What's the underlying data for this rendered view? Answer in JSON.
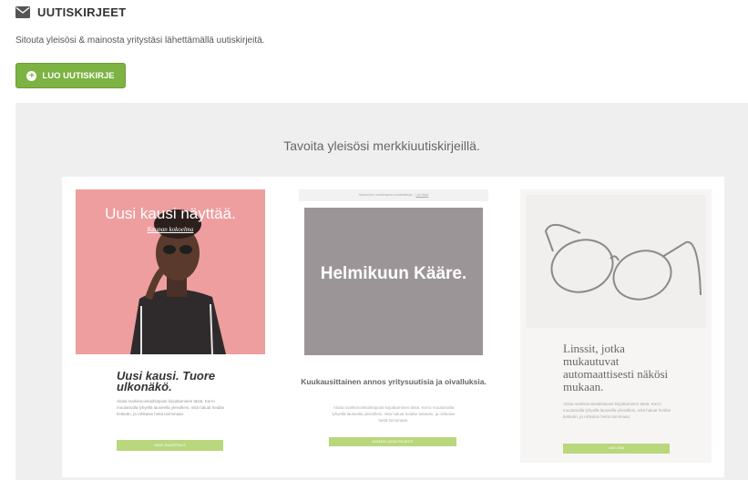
{
  "header": {
    "title": "UUTISKIRJEET",
    "icon": "envelope-icon",
    "subtitle": "Sitouta yleisösi & mainosta yritystäsi lähettämällä uutiskirjeitä."
  },
  "create_button": {
    "label": "LUO UUTISKIRJE",
    "icon": "plus-circle-icon",
    "color": "#7cb342"
  },
  "showcase": {
    "title": "Tavoita yleisösi merkkiuutiskirjeillä.",
    "templates": [
      {
        "hero_title": "Uusi kausi näyttää.",
        "hero_link": "Kaupan kokoelma",
        "body_title": "Uusi kausi. Tuore ulkonäkö.",
        "body_text": "Aloita markkinointiaihiöposti kirjoittaminen tästä. Kerro muutamalla lyhyellä lauseella yleisöllesi, mitä haluat heidän tietävän, ja rohkaise heitä toimimaan.",
        "cta": "HEIKE EVASTESILLE"
      },
      {
        "topbar_text": "Haaremme vanhempiasi osoiteitsitejsi...",
        "topbar_link": "Lue lisää",
        "hero_title": "Helmikuun Kääre.",
        "body_title": "Kuukausittainen annos yritysuutisia ja oivalluksia.",
        "body_text": "Aloita markkinointiaihiöposti kirjoittaminen tästä. Kerro muutamalla lyhyellä lauseella yleisöllesi, mitä haluat heidän tietävän, ja rohkaise heitä toimimaan.",
        "cta": "AUTAKSI UUSIN PROJEKTI"
      },
      {
        "body_title": "Linssit, jotka mukautuvat automaattisesti näkösi mukaan.",
        "body_text": "Aloita markkinointiaihiöposti kirjoittaminen tästä. Kerro muutamalla lyhyellä lauseella yleisöllesi, mitä haluat heidän tietävän, ja rohkaise heitä toimimaan.",
        "cta": "LUE LISÄÄ"
      }
    ]
  }
}
